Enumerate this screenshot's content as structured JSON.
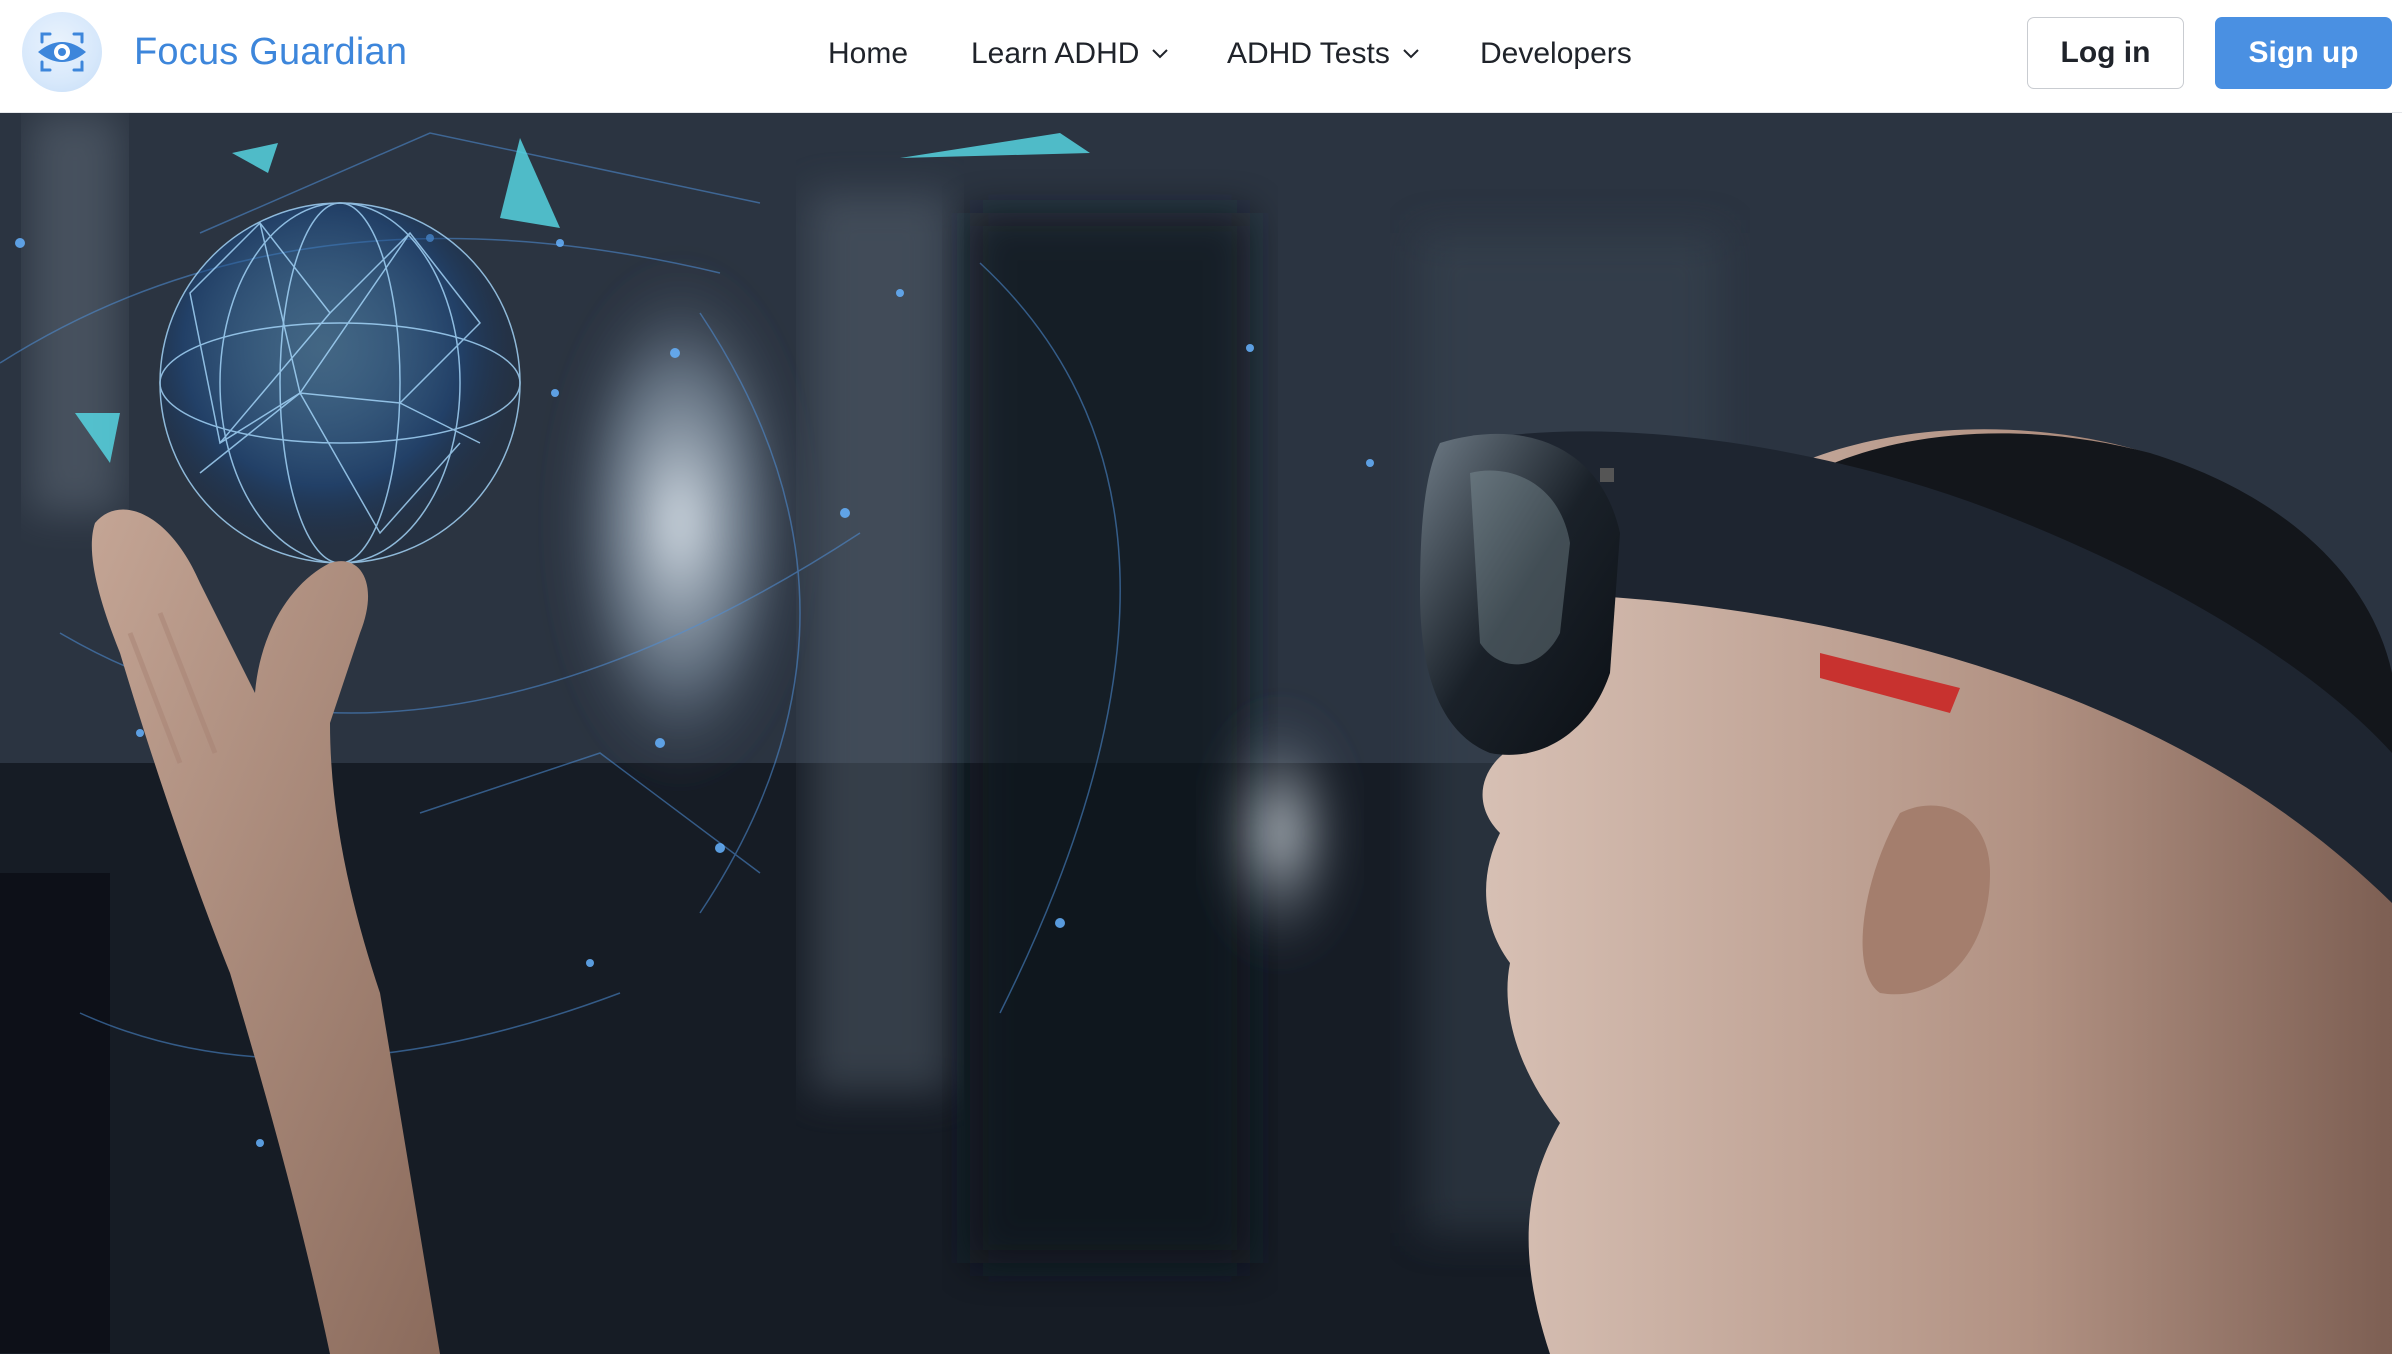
{
  "brand": {
    "name": "Focus Guardian",
    "logo_icon": "eye-focus-icon",
    "color": "#3d86db"
  },
  "nav": {
    "items": [
      {
        "label": "Home",
        "has_dropdown": false
      },
      {
        "label": "Learn ADHD",
        "has_dropdown": true,
        "icon": "chevron-down-icon"
      },
      {
        "label": "ADHD Tests",
        "has_dropdown": true,
        "icon": "chevron-down-icon"
      },
      {
        "label": "Developers",
        "has_dropdown": false
      }
    ]
  },
  "auth": {
    "login_label": "Log in",
    "signup_label": "Sign up",
    "signup_color": "#4a90e2"
  },
  "hero": {
    "image": "person-wearing-mixed-reality-headset-with-holographic-globe-image"
  }
}
